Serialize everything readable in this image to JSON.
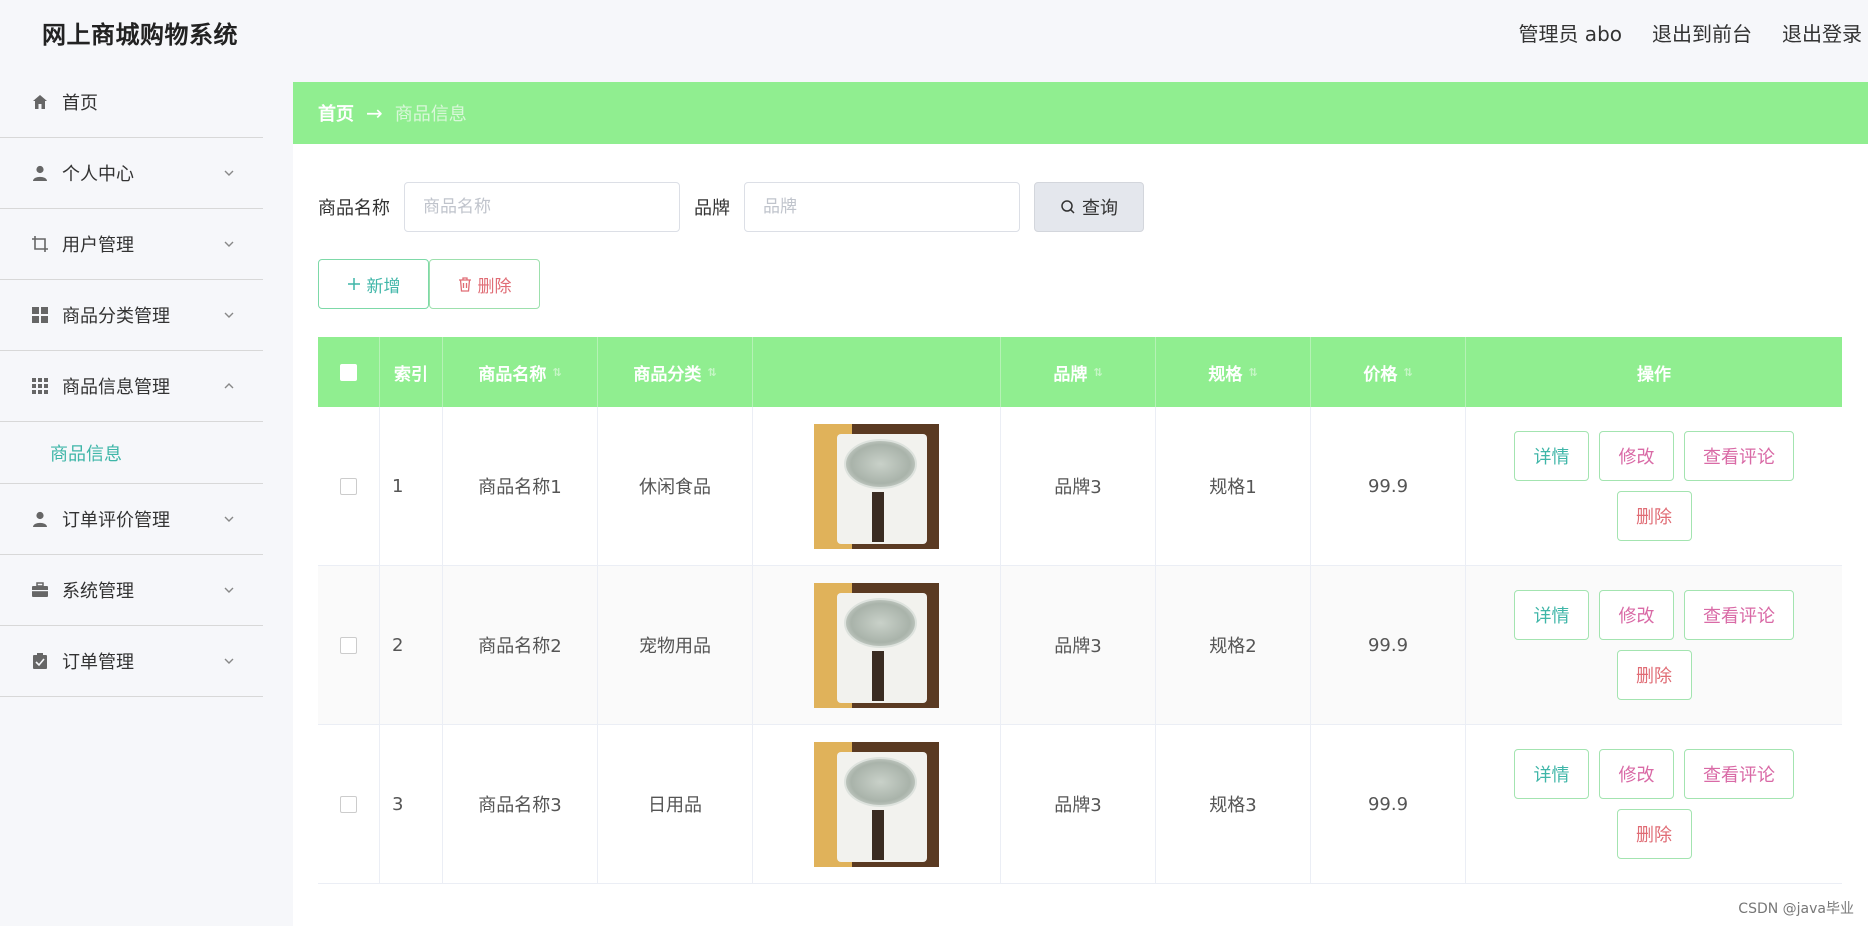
{
  "header": {
    "title": "网上商城购物系统",
    "user": "管理员 abo",
    "to_front": "退出到前台",
    "logout": "退出登录"
  },
  "sidebar": {
    "items": [
      {
        "label": "首页",
        "icon": "home-icon"
      },
      {
        "label": "个人中心",
        "icon": "user-icon"
      },
      {
        "label": "用户管理",
        "icon": "crop-icon"
      },
      {
        "label": "商品分类管理",
        "icon": "grid-icon"
      },
      {
        "label": "商品信息管理",
        "icon": "apps-icon"
      },
      {
        "label": "订单评价管理",
        "icon": "user-icon"
      },
      {
        "label": "系统管理",
        "icon": "briefcase-icon"
      },
      {
        "label": "订单管理",
        "icon": "clipboard-icon"
      }
    ],
    "submenu_active": "商品信息"
  },
  "breadcrumb": {
    "home": "首页",
    "arrow": "→",
    "current": "商品信息"
  },
  "search": {
    "name_label": "商品名称",
    "name_placeholder": "商品名称",
    "brand_label": "品牌",
    "brand_placeholder": "品牌",
    "query_label": "查询"
  },
  "actions": {
    "add_label": "新增",
    "delete_label": "删除"
  },
  "table": {
    "columns": [
      "索引",
      "商品名称",
      "商品分类",
      "",
      "品牌",
      "规格",
      "价格",
      "操作"
    ],
    "rows": [
      {
        "index": "1",
        "name": "商品名称1",
        "category": "休闲食品",
        "brand": "品牌3",
        "spec": "规格1",
        "price": "99.9"
      },
      {
        "index": "2",
        "name": "商品名称2",
        "category": "宠物用品",
        "brand": "品牌3",
        "spec": "规格2",
        "price": "99.9"
      },
      {
        "index": "3",
        "name": "商品名称3",
        "category": "日用品",
        "brand": "品牌3",
        "spec": "规格3",
        "price": "99.9"
      }
    ],
    "ops": {
      "view": "详情",
      "edit": "修改",
      "comment": "查看评论",
      "remove": "删除"
    }
  },
  "watermark": "CSDN @java毕业",
  "colors": {
    "accent_green": "#90ee90",
    "teal_text": "#3fb6a8",
    "pink_text": "#d96aa6",
    "red_text": "#e06c75"
  }
}
